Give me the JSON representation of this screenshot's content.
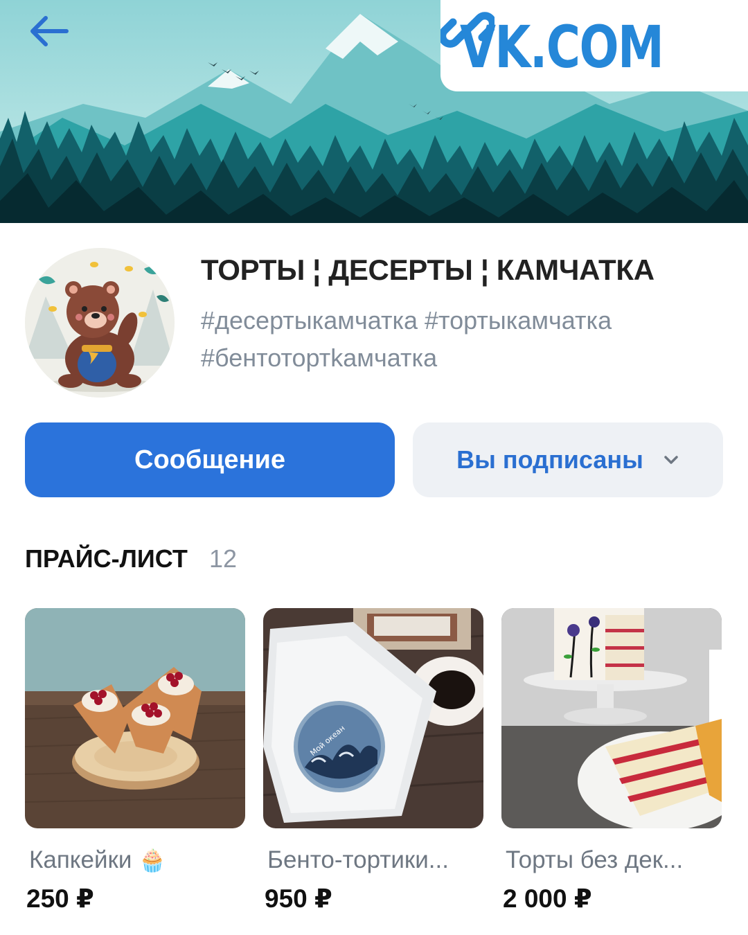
{
  "watermark": {
    "url": "VK.COM"
  },
  "group": {
    "name": "ТОРТЫ ¦ ДЕСЕРТЫ ¦ КАМЧАТКА",
    "status": "#десертыкамчатка #тортыкамчатка #бентотортkамчатка"
  },
  "actions": {
    "message_label": "Сообщение",
    "subscribed_label": "Вы подписаны"
  },
  "price_list": {
    "title": "ПРАЙС-ЛИСТ",
    "count": "12",
    "items": [
      {
        "name": "Капкейки",
        "emoji": "🧁",
        "price": "250 ₽"
      },
      {
        "name": "Бенто-тортики...",
        "price": "950 ₽"
      },
      {
        "name": "Торты без дек...",
        "price": "2 000 ₽"
      }
    ]
  },
  "colors": {
    "accent": "#2b73db",
    "accent_text": "#2a6fd1",
    "secondary_bg": "#eef1f5",
    "muted_text": "#818c99",
    "watermark": "#2587d8"
  }
}
